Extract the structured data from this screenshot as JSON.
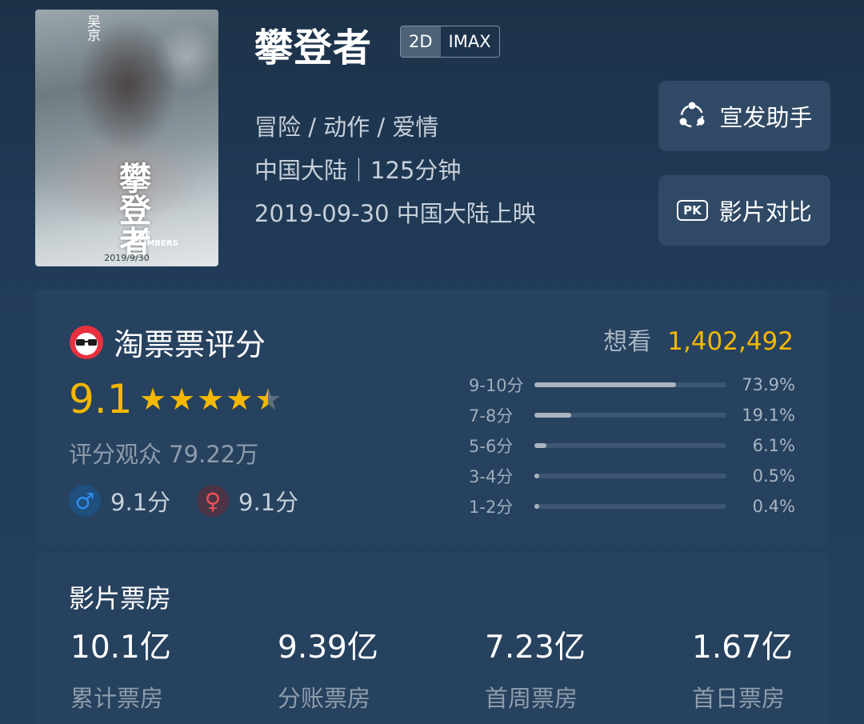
{
  "movie": {
    "title": "攀登者",
    "formats": [
      "2D",
      "IMAX"
    ],
    "genres": "冒险 / 动作 / 爱情",
    "region_duration": "中国大陆｜125分钟",
    "release": "2019-09-30 中国大陆上映"
  },
  "poster": {
    "actor": "吴京",
    "calligraphy": "攀登者",
    "english_title": "THE CLIMBERS",
    "date": "2019/9/30"
  },
  "actions": {
    "promo_label": "宣发助手",
    "compare_label": "影片对比",
    "compare_icon_text": "PK"
  },
  "rating": {
    "title": "淘票票评分",
    "score": "9.1",
    "stars": 4.5,
    "viewers": "评分观众 79.22万",
    "male_score": "9.1分",
    "female_score": "9.1分",
    "want_label": "想看",
    "want_count": "1,402,492",
    "distribution": [
      {
        "label": "9-10分",
        "percent": 73.9,
        "text": "73.9%"
      },
      {
        "label": "7-8分",
        "percent": 19.1,
        "text": "19.1%"
      },
      {
        "label": "5-6分",
        "percent": 6.1,
        "text": "6.1%"
      },
      {
        "label": "3-4分",
        "percent": 0.5,
        "text": "0.5%"
      },
      {
        "label": "1-2分",
        "percent": 0.4,
        "text": "0.4%"
      }
    ]
  },
  "box_office": {
    "title": "影片票房",
    "items": [
      {
        "value": "10.1亿",
        "label": "累计票房"
      },
      {
        "value": "9.39亿",
        "label": "分账票房"
      },
      {
        "value": "7.23亿",
        "label": "首周票房"
      },
      {
        "value": "1.67亿",
        "label": "首日票房"
      }
    ]
  },
  "colors": {
    "accent": "#f5b800",
    "male": "#2f8bf0",
    "female": "#f0505a"
  }
}
